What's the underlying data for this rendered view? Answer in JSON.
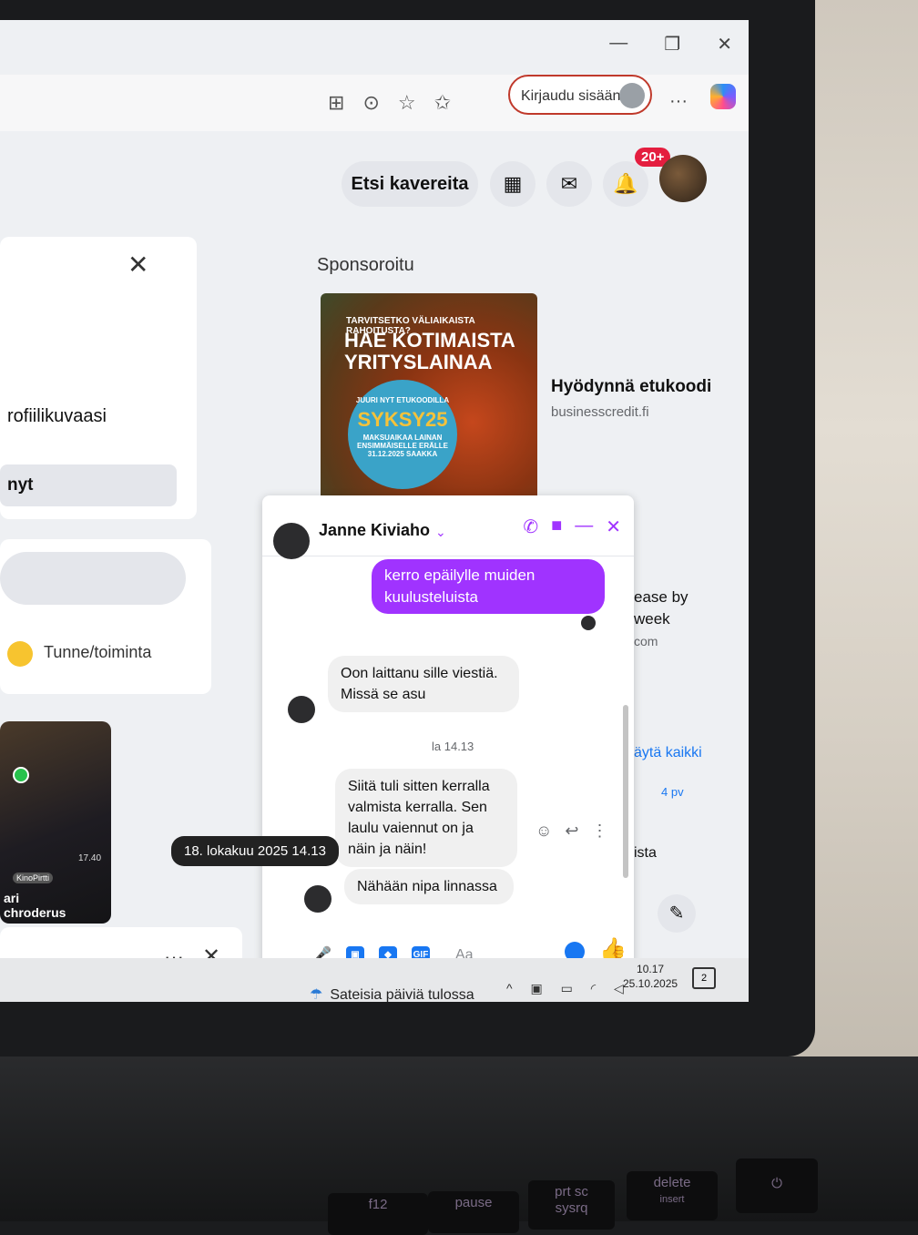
{
  "browser": {
    "signin_label": "Kirjaudu sisään"
  },
  "header": {
    "find_friends": "Etsi kavereita",
    "notifications_badge": "20+"
  },
  "feed": {
    "profile_picture_fragment": "rofiilikuvaasi",
    "button_fragment": "nyt",
    "feeling_activity": "Tunne/toiminta",
    "story": {
      "tag": "KinoPirtti",
      "name_line1": "ari",
      "name_line2": "chroderus",
      "duration": "17.40"
    }
  },
  "sponsored": {
    "label": "Sponsoroitu",
    "ad": {
      "question": "TARVITSETKO VÄLIAIKAISTA RAHOITUSTA?",
      "title": "HAE KOTIMAISTA YRITYSLAINAA",
      "circle_top": "JUURI NYT ETUKOODILLA",
      "code": "SYKSY25",
      "circle_bottom": "MAKSUAIKAA LAINAN ENSIMMÄISELLE ERÄLLE 31.12.2025 SAAKKA",
      "headline": "Hyödynnä etukoodi",
      "domain": "businesscredit.fi"
    }
  },
  "right_fragments": {
    "ease_by": "ease by",
    "week": "week",
    "com": "com",
    "see_all": "äytä kaikki",
    "days": "4 pv",
    "ista": "ista"
  },
  "chat": {
    "contact_name": "Janne Kiviaho",
    "messages": {
      "outgoing": "kerro epäilylle muiden kuulusteluista",
      "incoming_1": "Oon laittanu sille viestiä. Missä se asu",
      "time_separator": "la 14.13",
      "incoming_2": "Siitä tuli sitten kerralla valmista kerralla. Sen laulu vaiennut on ja näin ja näin!",
      "incoming_3": "Nähään nipa linnassa"
    },
    "tooltip": "18. lokakuu 2025 14.13",
    "composer_placeholder": "Aa"
  },
  "taskbar": {
    "weather": "Sateisia päiviä tulossa",
    "time": "10.17",
    "date": "25.10.2025",
    "notifications": "2"
  },
  "keyboard": {
    "keys": [
      "f12",
      "pause",
      "prt sc",
      "sysrq",
      "delete",
      "insert"
    ]
  },
  "colors": {
    "messenger_purple": "#a033ff",
    "facebook_blue": "#1877f2",
    "badge_red": "#e41e3f"
  }
}
